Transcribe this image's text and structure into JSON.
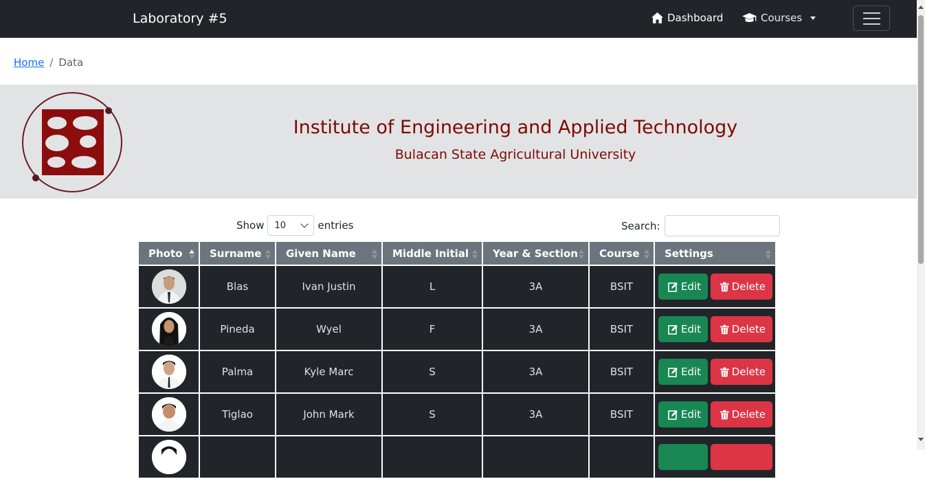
{
  "navbar": {
    "brand": "Laboratory #5",
    "dashboard_label": "Dashboard",
    "courses_label": "Courses",
    "dashboard_icon": "house-icon",
    "courses_icon": "graduation-cap-icon"
  },
  "breadcrumb": {
    "home": "Home",
    "current": "Data",
    "separator": "/"
  },
  "banner": {
    "title": "Institute of Engineering and Applied Technology",
    "subtitle": "Bulacan State Agricultural University",
    "title_color": "#7c0a02"
  },
  "controls": {
    "show_label": "Show",
    "entries_value": "10",
    "entries_label": "entries",
    "search_label": "Search:",
    "search_value": ""
  },
  "table": {
    "columns": [
      "Photo",
      "Surname",
      "Given Name",
      "Middle Initial",
      "Year & Section",
      "Course",
      "Settings"
    ],
    "rows": [
      {
        "surname": "Blas",
        "given": "Ivan Justin",
        "mi": "L",
        "section": "3A",
        "course": "BSIT"
      },
      {
        "surname": "Pineda",
        "given": "Wyel",
        "mi": "F",
        "section": "3A",
        "course": "BSIT"
      },
      {
        "surname": "Palma",
        "given": "Kyle Marc",
        "mi": "S",
        "section": "3A",
        "course": "BSIT"
      },
      {
        "surname": "Tiglao",
        "given": "John Mark",
        "mi": "S",
        "section": "3A",
        "course": "BSIT"
      }
    ],
    "edit_label": "Edit",
    "delete_label": "Delete"
  },
  "colors": {
    "navbar_bg": "#212529",
    "edit": "#198754",
    "delete": "#dc3545",
    "header_bg": "#6c757d"
  }
}
